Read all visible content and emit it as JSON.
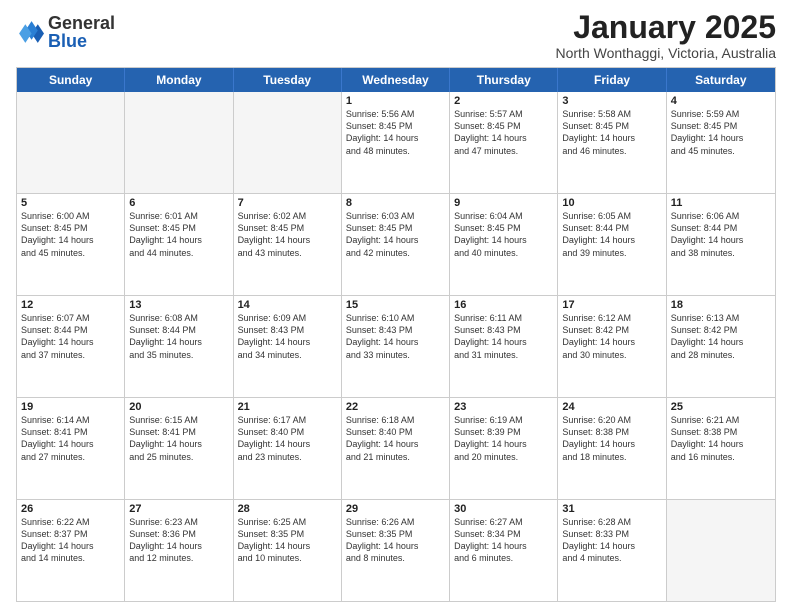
{
  "logo": {
    "general": "General",
    "blue": "Blue"
  },
  "title": "January 2025",
  "location": "North Wonthaggi, Victoria, Australia",
  "header_days": [
    "Sunday",
    "Monday",
    "Tuesday",
    "Wednesday",
    "Thursday",
    "Friday",
    "Saturday"
  ],
  "rows": [
    [
      {
        "day": "",
        "info": "",
        "empty": true
      },
      {
        "day": "",
        "info": "",
        "empty": true
      },
      {
        "day": "",
        "info": "",
        "empty": true
      },
      {
        "day": "1",
        "info": "Sunrise: 5:56 AM\nSunset: 8:45 PM\nDaylight: 14 hours\nand 48 minutes."
      },
      {
        "day": "2",
        "info": "Sunrise: 5:57 AM\nSunset: 8:45 PM\nDaylight: 14 hours\nand 47 minutes."
      },
      {
        "day": "3",
        "info": "Sunrise: 5:58 AM\nSunset: 8:45 PM\nDaylight: 14 hours\nand 46 minutes."
      },
      {
        "day": "4",
        "info": "Sunrise: 5:59 AM\nSunset: 8:45 PM\nDaylight: 14 hours\nand 45 minutes."
      }
    ],
    [
      {
        "day": "5",
        "info": "Sunrise: 6:00 AM\nSunset: 8:45 PM\nDaylight: 14 hours\nand 45 minutes."
      },
      {
        "day": "6",
        "info": "Sunrise: 6:01 AM\nSunset: 8:45 PM\nDaylight: 14 hours\nand 44 minutes."
      },
      {
        "day": "7",
        "info": "Sunrise: 6:02 AM\nSunset: 8:45 PM\nDaylight: 14 hours\nand 43 minutes."
      },
      {
        "day": "8",
        "info": "Sunrise: 6:03 AM\nSunset: 8:45 PM\nDaylight: 14 hours\nand 42 minutes."
      },
      {
        "day": "9",
        "info": "Sunrise: 6:04 AM\nSunset: 8:45 PM\nDaylight: 14 hours\nand 40 minutes."
      },
      {
        "day": "10",
        "info": "Sunrise: 6:05 AM\nSunset: 8:44 PM\nDaylight: 14 hours\nand 39 minutes."
      },
      {
        "day": "11",
        "info": "Sunrise: 6:06 AM\nSunset: 8:44 PM\nDaylight: 14 hours\nand 38 minutes."
      }
    ],
    [
      {
        "day": "12",
        "info": "Sunrise: 6:07 AM\nSunset: 8:44 PM\nDaylight: 14 hours\nand 37 minutes."
      },
      {
        "day": "13",
        "info": "Sunrise: 6:08 AM\nSunset: 8:44 PM\nDaylight: 14 hours\nand 35 minutes."
      },
      {
        "day": "14",
        "info": "Sunrise: 6:09 AM\nSunset: 8:43 PM\nDaylight: 14 hours\nand 34 minutes."
      },
      {
        "day": "15",
        "info": "Sunrise: 6:10 AM\nSunset: 8:43 PM\nDaylight: 14 hours\nand 33 minutes."
      },
      {
        "day": "16",
        "info": "Sunrise: 6:11 AM\nSunset: 8:43 PM\nDaylight: 14 hours\nand 31 minutes."
      },
      {
        "day": "17",
        "info": "Sunrise: 6:12 AM\nSunset: 8:42 PM\nDaylight: 14 hours\nand 30 minutes."
      },
      {
        "day": "18",
        "info": "Sunrise: 6:13 AM\nSunset: 8:42 PM\nDaylight: 14 hours\nand 28 minutes."
      }
    ],
    [
      {
        "day": "19",
        "info": "Sunrise: 6:14 AM\nSunset: 8:41 PM\nDaylight: 14 hours\nand 27 minutes."
      },
      {
        "day": "20",
        "info": "Sunrise: 6:15 AM\nSunset: 8:41 PM\nDaylight: 14 hours\nand 25 minutes."
      },
      {
        "day": "21",
        "info": "Sunrise: 6:17 AM\nSunset: 8:40 PM\nDaylight: 14 hours\nand 23 minutes."
      },
      {
        "day": "22",
        "info": "Sunrise: 6:18 AM\nSunset: 8:40 PM\nDaylight: 14 hours\nand 21 minutes."
      },
      {
        "day": "23",
        "info": "Sunrise: 6:19 AM\nSunset: 8:39 PM\nDaylight: 14 hours\nand 20 minutes."
      },
      {
        "day": "24",
        "info": "Sunrise: 6:20 AM\nSunset: 8:38 PM\nDaylight: 14 hours\nand 18 minutes."
      },
      {
        "day": "25",
        "info": "Sunrise: 6:21 AM\nSunset: 8:38 PM\nDaylight: 14 hours\nand 16 minutes."
      }
    ],
    [
      {
        "day": "26",
        "info": "Sunrise: 6:22 AM\nSunset: 8:37 PM\nDaylight: 14 hours\nand 14 minutes."
      },
      {
        "day": "27",
        "info": "Sunrise: 6:23 AM\nSunset: 8:36 PM\nDaylight: 14 hours\nand 12 minutes."
      },
      {
        "day": "28",
        "info": "Sunrise: 6:25 AM\nSunset: 8:35 PM\nDaylight: 14 hours\nand 10 minutes."
      },
      {
        "day": "29",
        "info": "Sunrise: 6:26 AM\nSunset: 8:35 PM\nDaylight: 14 hours\nand 8 minutes."
      },
      {
        "day": "30",
        "info": "Sunrise: 6:27 AM\nSunset: 8:34 PM\nDaylight: 14 hours\nand 6 minutes."
      },
      {
        "day": "31",
        "info": "Sunrise: 6:28 AM\nSunset: 8:33 PM\nDaylight: 14 hours\nand 4 minutes."
      },
      {
        "day": "",
        "info": "",
        "empty": true
      }
    ]
  ]
}
